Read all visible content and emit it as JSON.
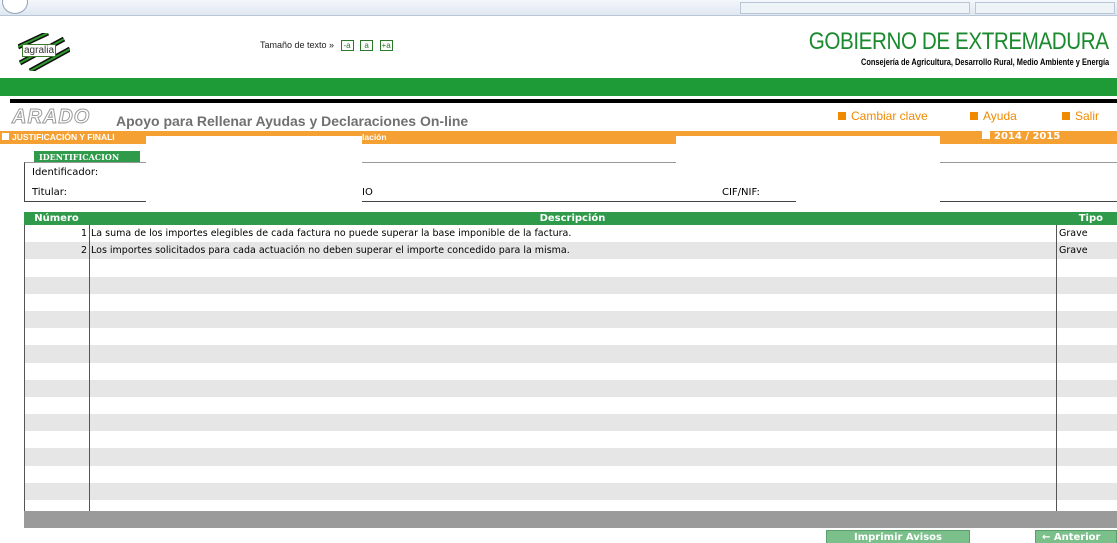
{
  "header": {
    "logo_text": "agralia",
    "text_size_label": "Tamaño de texto »",
    "text_size_buttons": [
      "-a",
      "a",
      "+a"
    ],
    "gov_title": "GOBIERNO DE EXTREMADURA",
    "gov_subtitle": "Consejería de Agricultura, Desarrollo Rural, Medio Ambiente y Energía"
  },
  "app": {
    "name": "ARADO",
    "subtitle": "Apoyo para Rellenar Ayudas y Declaraciones On-line",
    "links": {
      "change_password": "Cambiar clave",
      "help": "Ayuda",
      "exit": "Salir"
    }
  },
  "orange_band": {
    "left_text": "JUSTIFICACIÓN Y FINALI",
    "mid_text": "lación",
    "year": "2014 / 2015"
  },
  "identification": {
    "tab_label": "IDENTIFICACION",
    "identifier_label": "Identificador:",
    "holder_label": "Titular:",
    "holder_value_partial": "IO",
    "cif_label": "CIF/NIF:"
  },
  "table": {
    "headers": {
      "number": "Número",
      "description": "Descripción",
      "type": "Tipo"
    },
    "rows": [
      {
        "number": "1",
        "description": "La suma de los importes elegibles de cada factura no puede superar la base imponible de la factura.",
        "type": "Grave"
      },
      {
        "number": "2",
        "description": "Los importes solicitados para cada actuación no deben superar el importe concedido para la misma.",
        "type": "Grave"
      },
      {
        "number": "",
        "description": "",
        "type": ""
      },
      {
        "number": "",
        "description": "",
        "type": ""
      },
      {
        "number": "",
        "description": "",
        "type": ""
      },
      {
        "number": "",
        "description": "",
        "type": ""
      },
      {
        "number": "",
        "description": "",
        "type": ""
      },
      {
        "number": "",
        "description": "",
        "type": ""
      },
      {
        "number": "",
        "description": "",
        "type": ""
      },
      {
        "number": "",
        "description": "",
        "type": ""
      },
      {
        "number": "",
        "description": "",
        "type": ""
      },
      {
        "number": "",
        "description": "",
        "type": ""
      },
      {
        "number": "",
        "description": "",
        "type": ""
      },
      {
        "number": "",
        "description": "",
        "type": ""
      },
      {
        "number": "",
        "description": "",
        "type": ""
      },
      {
        "number": "",
        "description": "",
        "type": ""
      },
      {
        "number": "",
        "description": "",
        "type": ""
      }
    ]
  },
  "buttons": {
    "print": "Imprimir Avisos",
    "back": "← Anterior"
  },
  "colors": {
    "green": "#1e9a36",
    "table_header_green": "#2e9a4a",
    "orange": "#f5a033",
    "link_orange": "#f08a00"
  }
}
